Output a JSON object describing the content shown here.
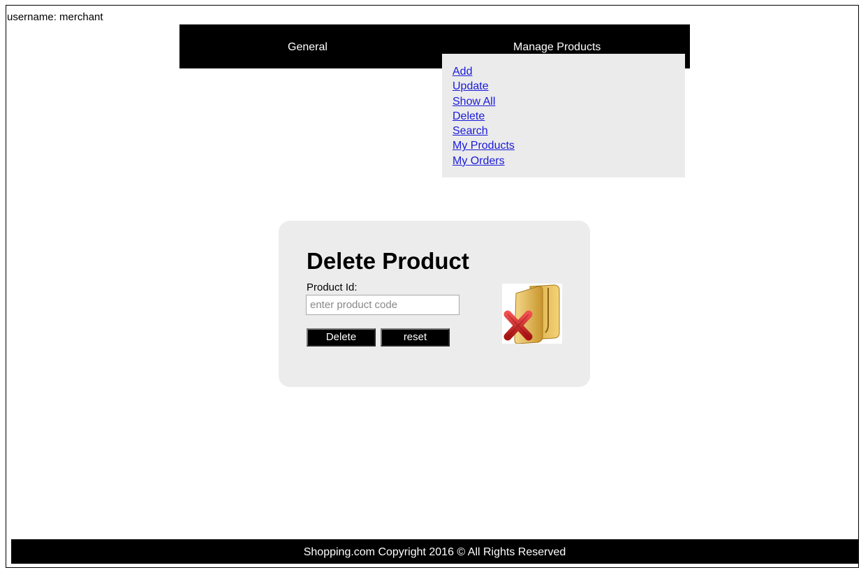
{
  "user": {
    "username_text": "username: merchant"
  },
  "nav": {
    "general_label": "General",
    "manage_products_label": "Manage Products"
  },
  "dropdown": {
    "items": [
      {
        "label": "Add"
      },
      {
        "label": "Update"
      },
      {
        "label": "Show All"
      },
      {
        "label": "Delete"
      },
      {
        "label": "Search"
      },
      {
        "label": "My Products"
      },
      {
        "label": "My Orders"
      }
    ]
  },
  "form": {
    "title": "Delete Product",
    "product_id_label": "Product Id:",
    "product_id_placeholder": "enter product code",
    "product_id_value": "",
    "delete_label": "Delete",
    "reset_label": "reset",
    "image_icon": "folder-delete-icon"
  },
  "footer": {
    "copyright_text": "Shopping.com Copyright 2016 © All Rights Reserved"
  },
  "colors": {
    "nav_background": "#000000",
    "dropdown_background": "#ebebeb",
    "link_color": "#1a1adb",
    "card_background": "#ececec",
    "footer_background": "#000000"
  }
}
